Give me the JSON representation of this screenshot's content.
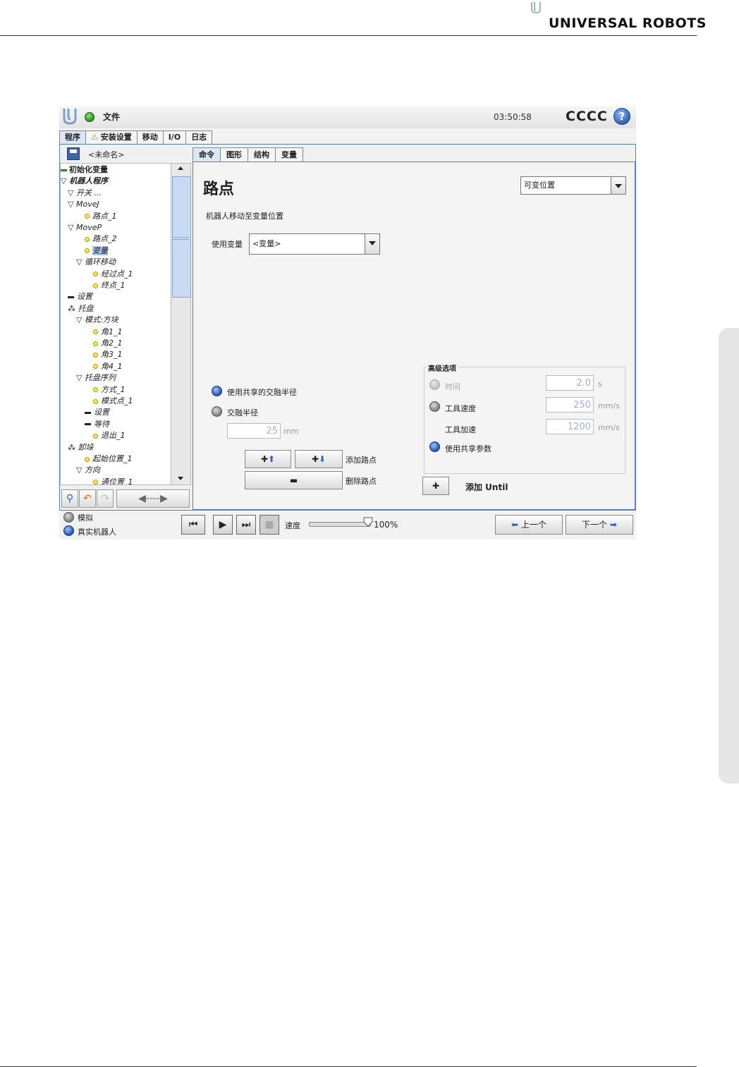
{
  "brand": {
    "name": "UNIVERSAL ROBOTS"
  },
  "topbar": {
    "file_menu": "文件",
    "clock": "03:50:58",
    "robot_name": "CCCC",
    "help": "?"
  },
  "main_tabs": [
    {
      "label": "程序",
      "active": true
    },
    {
      "label": "安装设置",
      "warning": true
    },
    {
      "label": "移动"
    },
    {
      "label": "I/O"
    },
    {
      "label": "日志"
    }
  ],
  "program": {
    "name": "<未命名>"
  },
  "tree": [
    {
      "label": "初始化变量",
      "icon": "bar-green",
      "indent": 0,
      "bold": true
    },
    {
      "label": "机器人程序",
      "icon": "triangle",
      "indent": 0,
      "bold": true,
      "italic": true
    },
    {
      "label": "开关 ...",
      "icon": "triangle",
      "indent": 1,
      "italic": true
    },
    {
      "label": "MoveJ",
      "icon": "triangle",
      "indent": 1,
      "italic": true
    },
    {
      "label": "路点_1",
      "icon": "dot",
      "indent": 2,
      "italic": true
    },
    {
      "label": "MoveP",
      "icon": "triangle",
      "indent": 1,
      "italic": true
    },
    {
      "label": "路点_2",
      "icon": "dot",
      "indent": 2,
      "italic": true
    },
    {
      "label": "变量",
      "icon": "dot",
      "indent": 2,
      "italic": true,
      "selected": true
    },
    {
      "label": "循环移动",
      "icon": "triangle",
      "indent": 2,
      "italic": true
    },
    {
      "label": "经过点_1",
      "icon": "dot",
      "indent": 3,
      "italic": true
    },
    {
      "label": "终点_1",
      "icon": "dot",
      "indent": 3,
      "italic": true
    },
    {
      "label": "设置",
      "icon": "bar",
      "indent": 1,
      "italic": true
    },
    {
      "label": "托盘",
      "icon": "pallet",
      "indent": 1,
      "italic": true
    },
    {
      "label": "模式:方块",
      "icon": "triangle",
      "indent": 2,
      "italic": true
    },
    {
      "label": "角1_1",
      "icon": "dot",
      "indent": 3,
      "italic": true
    },
    {
      "label": "角2_1",
      "icon": "dot",
      "indent": 3,
      "italic": true
    },
    {
      "label": "角3_1",
      "icon": "dot",
      "indent": 3,
      "italic": true
    },
    {
      "label": "角4_1",
      "icon": "dot",
      "indent": 3,
      "italic": true
    },
    {
      "label": "托盘序列",
      "icon": "triangle",
      "indent": 2,
      "italic": true
    },
    {
      "label": "方式_1",
      "icon": "dot",
      "indent": 3,
      "italic": true
    },
    {
      "label": "模式点_1",
      "icon": "dot",
      "indent": 3,
      "italic": true
    },
    {
      "label": "设置",
      "icon": "bar",
      "indent": 3,
      "italic": true
    },
    {
      "label": "等待",
      "icon": "bar",
      "indent": 3,
      "italic": true
    },
    {
      "label": "退出_1",
      "icon": "dot",
      "indent": 3,
      "italic": true
    },
    {
      "label": "卸垛",
      "icon": "pallet",
      "indent": 1,
      "italic": true
    },
    {
      "label": "起始位置_1",
      "icon": "dot",
      "indent": 2,
      "italic": true
    },
    {
      "label": "方向",
      "icon": "triangle",
      "indent": 2,
      "italic": true
    },
    {
      "label": "通位置_1",
      "icon": "dot",
      "indent": 3,
      "italic": true
    }
  ],
  "sub_tabs": [
    {
      "label": "命令",
      "active": true
    },
    {
      "label": "图形"
    },
    {
      "label": "结构"
    },
    {
      "label": "变量"
    }
  ],
  "waypoint": {
    "title": "路点",
    "type_select": "可变位置",
    "description": "机器人移动至变量位置",
    "use_variable_label": "使用变量",
    "use_variable_value": "<变量>"
  },
  "blend": {
    "shared_label": "使用共享的交融半径",
    "radius_label": "交融半径",
    "radius_value": "25",
    "radius_unit": "mm"
  },
  "waypoint_actions": {
    "add_label": "添加路点",
    "delete_label": "删除路点"
  },
  "advanced": {
    "title": "高级选项",
    "time_label": "时间",
    "time_value": "2.0",
    "time_unit": "s",
    "tool_speed_label": "工具速度",
    "tool_speed_value": "250",
    "tool_speed_unit": "mm/s",
    "tool_accel_label": "工具加速",
    "tool_accel_value": "1200",
    "tool_accel_unit": "mm/s",
    "shared_params_label": "使用共享参数",
    "add_until_label": "添加 Until"
  },
  "mode": {
    "simulation": "模拟",
    "real": "真实机器人"
  },
  "speed": {
    "label": "速度",
    "value": "100%",
    "fraction": 1.0
  },
  "nav": {
    "prev": "上一个",
    "next": "下一个"
  }
}
